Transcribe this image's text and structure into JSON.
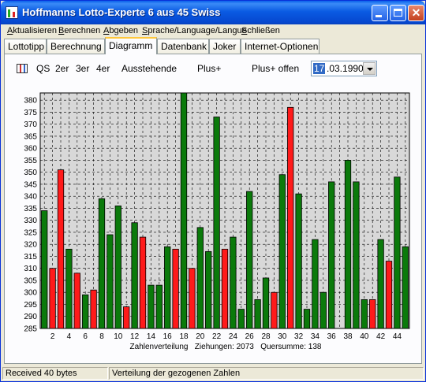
{
  "window": {
    "title": "Hoffmanns Lotto-Experte  6 aus 45 Swiss"
  },
  "menu": [
    {
      "u": "A",
      "rest": "ktualisieren"
    },
    {
      "u": "B",
      "rest": "erechnen"
    },
    {
      "u": "A",
      "rest": "bgeben"
    },
    {
      "u": "S",
      "rest": "prache/Language/Langue"
    },
    {
      "u": "S",
      "rest": "chließen"
    }
  ],
  "tabs": [
    "Lottotipp",
    "Berechnung",
    "Diagramm",
    "Datenbank",
    "Joker",
    "Internet-Optionen"
  ],
  "active_tab": "Diagramm",
  "toolbar": {
    "qs": "QS",
    "t2": "2er",
    "t3": "3er",
    "t4": "4er",
    "ausstehende": "Ausstehende",
    "plus": "Plus+",
    "plus_offen": "Plus+ offen",
    "date_sel": "17",
    "date_rest": ".03.1990"
  },
  "colors": {
    "green": "#0B7A0B",
    "red": "#FF1A1A",
    "plot_bg": "#D8D8D8"
  },
  "chart_data": {
    "type": "bar",
    "caption": "Zahlenverteilung   Ziehungen: 2073   Quersumme: 138",
    "x": [
      1,
      2,
      3,
      4,
      5,
      6,
      7,
      8,
      9,
      10,
      11,
      12,
      13,
      14,
      15,
      16,
      17,
      18,
      19,
      20,
      21,
      22,
      23,
      24,
      25,
      26,
      27,
      28,
      29,
      30,
      31,
      32,
      33,
      34,
      35,
      36,
      37,
      38,
      39,
      40,
      41,
      42,
      43,
      44,
      45
    ],
    "x_tick_labels": [
      "2",
      "4",
      "6",
      "8",
      "10",
      "12",
      "14",
      "16",
      "18",
      "20",
      "22",
      "24",
      "26",
      "28",
      "30",
      "32",
      "34",
      "36",
      "38",
      "40",
      "42",
      "44"
    ],
    "y_tick_labels": [
      "285",
      "290",
      "295",
      "300",
      "305",
      "310",
      "315",
      "320",
      "325",
      "330",
      "335",
      "340",
      "345",
      "350",
      "355",
      "360",
      "365",
      "370",
      "375",
      "380"
    ],
    "values": [
      334,
      310,
      351,
      318,
      308,
      299,
      301,
      339,
      324,
      336,
      294,
      329,
      323,
      303,
      303,
      319,
      318,
      384,
      310,
      327,
      317,
      373,
      318,
      323,
      293,
      342,
      297,
      306,
      300,
      349,
      377,
      341,
      293,
      322,
      300,
      346,
      285,
      355,
      346,
      297,
      297,
      322,
      313,
      348,
      319
    ],
    "highlighted": [
      2,
      3,
      5,
      7,
      11,
      13,
      17,
      19,
      23,
      29,
      31,
      41,
      43
    ],
    "ylim": [
      285,
      383
    ],
    "grid": true
  },
  "status": {
    "left": "Received 40 bytes",
    "right": "Verteilung der gezogenen Zahlen"
  }
}
